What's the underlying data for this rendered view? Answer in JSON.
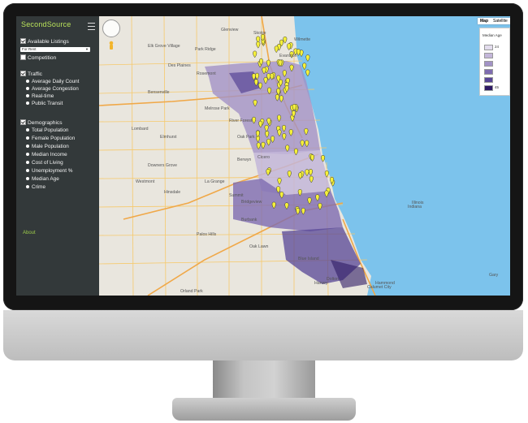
{
  "sidebar": {
    "brand": "SecondSource",
    "available_listings": "Available Listings",
    "listing_select": "For Rent",
    "competition": "Competition",
    "traffic": "Traffic",
    "traffic_items": [
      "Average Daily Count",
      "Average Congestion",
      "Real-time",
      "Public Transit"
    ],
    "demographics": "Demographics",
    "demographic_items": [
      "Total Population",
      "Female Population",
      "Male Population",
      "Median Income",
      "Cost of Living",
      "Unemployment %",
      "Median Age",
      "Crime"
    ],
    "about": "About"
  },
  "map": {
    "toggle": [
      "Map",
      "Satellite"
    ],
    "legend": {
      "title": "Median Age",
      "min_label": "24",
      "max_label": "45",
      "colors": [
        "#e3dced",
        "#c3b6d9",
        "#a292c6",
        "#7e6cb0",
        "#574596",
        "#2e1a64"
      ]
    },
    "places": [
      "Skokie",
      "Evanston",
      "Elk Grove Village",
      "Rosemont",
      "River Forest",
      "Oak Park",
      "Elmhurst",
      "Lombard",
      "Berwyn",
      "Cicero",
      "Hinsdale",
      "Summit",
      "Burbank",
      "Oak Lawn",
      "Blue Island",
      "Orland Park",
      "Harvey",
      "Dolton",
      "Calumet City",
      "Hammond",
      "Gary",
      "Park Ridge",
      "Des Plaines",
      "Glenview",
      "Wilmette",
      "Bensenville",
      "Melrose Park",
      "La Grange",
      "Westmont",
      "Downers Grove",
      "Bridgeview",
      "Palos Hills",
      "Indiana",
      "Illinois"
    ],
    "colors": {
      "land": "#e9e6de",
      "water": "#7cc3ec",
      "road": "#f6c96b",
      "highway": "#f0a848",
      "marker": "#f5f03a"
    }
  }
}
